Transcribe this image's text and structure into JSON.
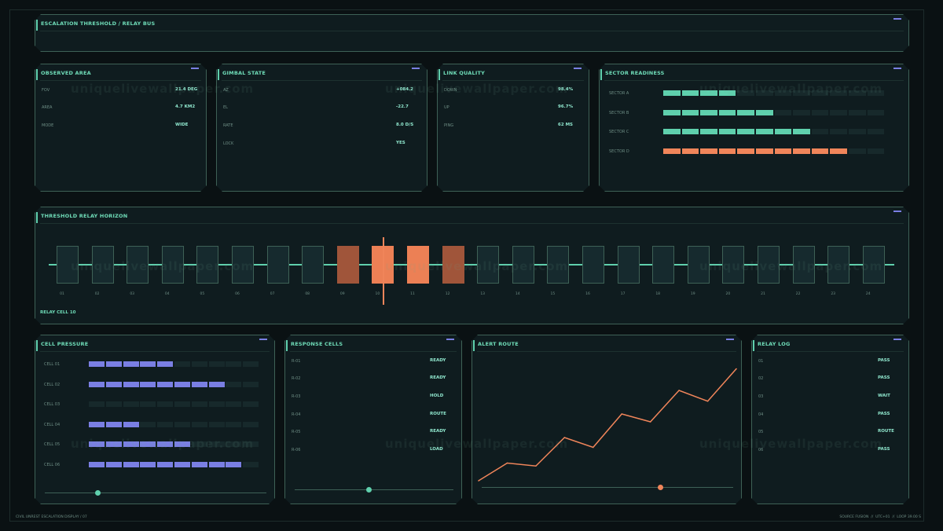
{
  "header": {
    "title": "ESCALATION THRESHOLD / RELAY BUS"
  },
  "observed_area": {
    "title": "OBSERVED AREA",
    "rows": [
      {
        "label": "FOV",
        "value": "21.4 DEG"
      },
      {
        "label": "AREA",
        "value": "4.7 KM2"
      },
      {
        "label": "MODE",
        "value": "WIDE"
      }
    ]
  },
  "gimbal_state": {
    "title": "GIMBAL STATE",
    "rows": [
      {
        "label": "AZ",
        "value": "+084.2"
      },
      {
        "label": "EL",
        "value": "-22.7"
      },
      {
        "label": "RATE",
        "value": "8.0 D/S"
      },
      {
        "label": "LOCK",
        "value": "YES"
      }
    ]
  },
  "link_quality": {
    "title": "LINK QUALITY",
    "rows": [
      {
        "label": "DOWN",
        "value": "98.4%"
      },
      {
        "label": "UP",
        "value": "96.7%"
      },
      {
        "label": "PING",
        "value": "62 MS"
      }
    ]
  },
  "sector_readiness": {
    "title": "SECTOR READINESS",
    "total_segments": 12,
    "rows": [
      {
        "label": "SECTOR A",
        "filled": 4,
        "color": "#5fd0ad"
      },
      {
        "label": "SECTOR B",
        "filled": 6,
        "color": "#5fd0ad"
      },
      {
        "label": "SECTOR C",
        "filled": 8,
        "color": "#5fd0ad"
      },
      {
        "label": "SECTOR D",
        "filled": 10,
        "color": "#f0855a"
      }
    ]
  },
  "relay_horizon": {
    "title": "THRESHOLD RELAY HORIZON",
    "cells": [
      "01",
      "02",
      "03",
      "04",
      "05",
      "06",
      "07",
      "08",
      "09",
      "10",
      "11",
      "12",
      "13",
      "14",
      "15",
      "16",
      "17",
      "18",
      "19",
      "20",
      "21",
      "22",
      "23",
      "24"
    ],
    "active_cells": [
      "09",
      "10",
      "11",
      "12"
    ],
    "selected_cell": "10",
    "caption": "RELAY CELL 10",
    "colors": {
      "idle": "#162a2e",
      "active": "#a0553a",
      "hot": "#ec8055",
      "cursor": "#f0855a",
      "line": "#5fd0ad"
    }
  },
  "cell_pressure": {
    "title": "CELL PRESSURE",
    "total_segments": 10,
    "rows": [
      {
        "label": "CELL 01",
        "filled": 5
      },
      {
        "label": "CELL 02",
        "filled": 8
      },
      {
        "label": "CELL 03",
        "filled": 0
      },
      {
        "label": "CELL 04",
        "filled": 3
      },
      {
        "label": "CELL 05",
        "filled": 6
      },
      {
        "label": "CELL 06",
        "filled": 9
      }
    ],
    "color": "#7a7fe3",
    "slider_value": 0.24
  },
  "response_cells": {
    "title": "RESPONSE CELLS",
    "rows": [
      {
        "label": "R-01",
        "value": "READY"
      },
      {
        "label": "R-02",
        "value": "READY"
      },
      {
        "label": "R-03",
        "value": "HOLD"
      },
      {
        "label": "R-04",
        "value": "ROUTE"
      },
      {
        "label": "R-05",
        "value": "READY"
      },
      {
        "label": "R-06",
        "value": "LOAD"
      }
    ],
    "slider_value": 0.47
  },
  "alert_route": {
    "title": "ALERT ROUTE",
    "slider_value": 0.71
  },
  "chart_data": {
    "type": "line",
    "title": "ALERT ROUTE",
    "xlabel": "",
    "ylabel": "",
    "x": [
      0,
      1,
      2,
      3,
      4,
      5,
      6,
      7,
      8,
      9
    ],
    "series": [
      {
        "values": [
          4,
          22,
          19,
          48,
          38,
          72,
          64,
          96,
          85,
          118
        ]
      }
    ],
    "ylim": [
      0,
      120
    ],
    "grid": false,
    "color": "#f0855a"
  },
  "relay_log": {
    "title": "RELAY LOG",
    "rows": [
      {
        "label": "01",
        "value": "PASS"
      },
      {
        "label": "02",
        "value": "PASS"
      },
      {
        "label": "03",
        "value": "WAIT"
      },
      {
        "label": "04",
        "value": "PASS"
      },
      {
        "label": "05",
        "value": "ROUTE"
      },
      {
        "label": "06",
        "value": "PASS"
      }
    ]
  },
  "footer": {
    "left": "CIVIL UNREST ESCALATION DISPLAY / 07",
    "right": "SOURCE FUSION  //  UTC+01  //  LOOP 39.00 S"
  },
  "watermark": "uniquelivewallpaper.com"
}
